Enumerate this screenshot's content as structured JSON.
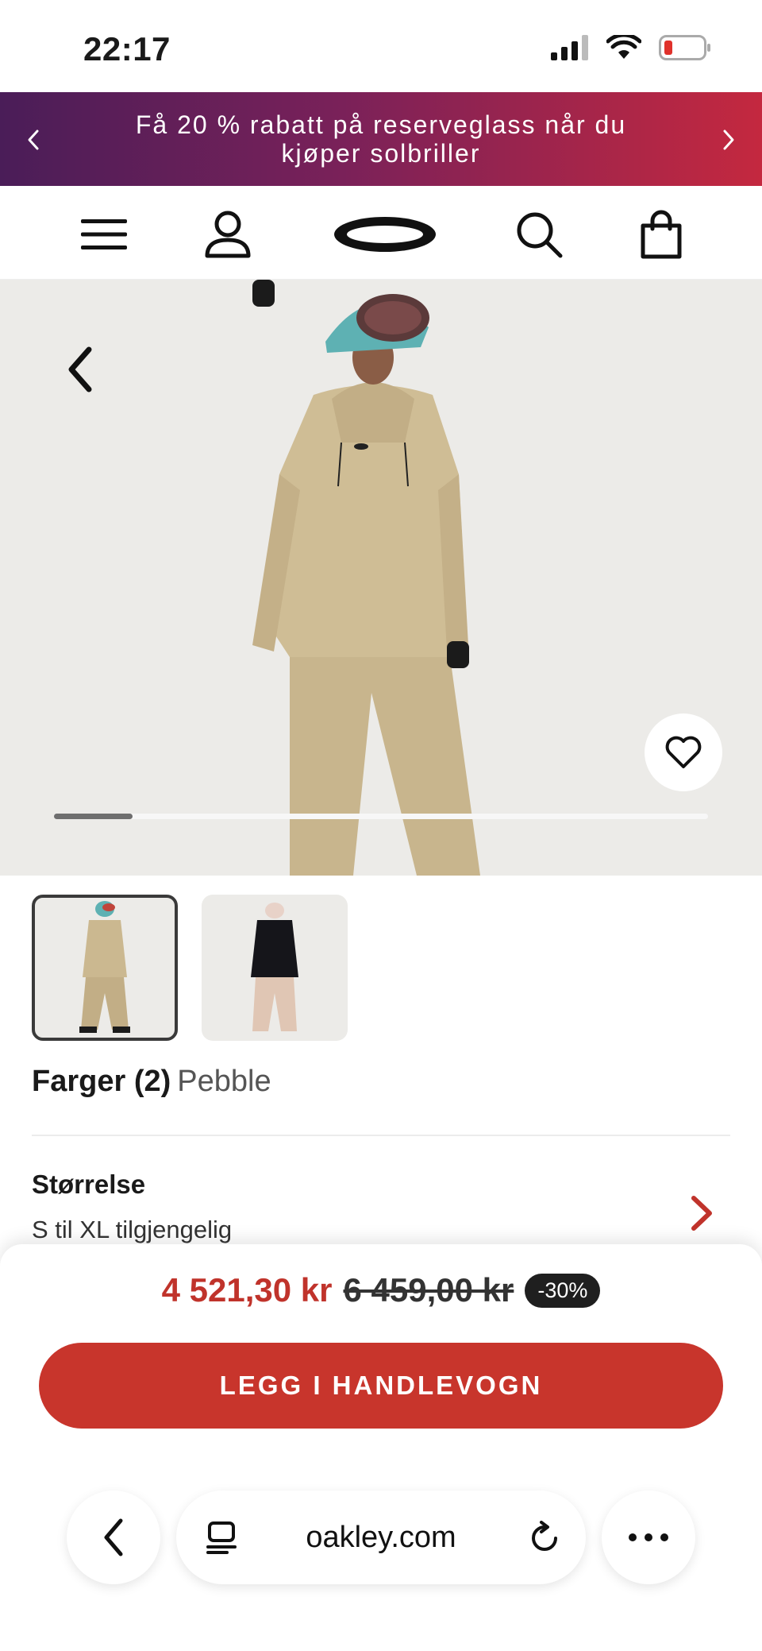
{
  "status_bar": {
    "time": "22:17"
  },
  "promo": {
    "text": "Få 20 % rabatt på reserveglass når du kjøper solbriller"
  },
  "product": {
    "colors_label": "Farger (2)",
    "color_value": "Pebble",
    "size_title": "Størrelse",
    "size_availability": "S til XL tilgjengelig"
  },
  "pricing": {
    "current": "4 521,30 kr",
    "original": "6 459,00 kr",
    "discount": "-30%"
  },
  "cta": {
    "label": "LEGG I HANDLEVOGN"
  },
  "browser": {
    "url": "oakley.com"
  },
  "carousel": {
    "position": 0.12
  },
  "colors": {
    "accent": "#c8352c",
    "price": "#c0332b",
    "banner_start": "#4a1d58",
    "banner_end": "#c4283f"
  },
  "icons": [
    "hamburger-icon",
    "account-icon",
    "oakley-logo-icon",
    "search-icon",
    "bag-icon",
    "back-arrow-icon",
    "heart-icon",
    "chevron-right-icon",
    "tabs-icon",
    "reload-icon",
    "more-icon"
  ]
}
